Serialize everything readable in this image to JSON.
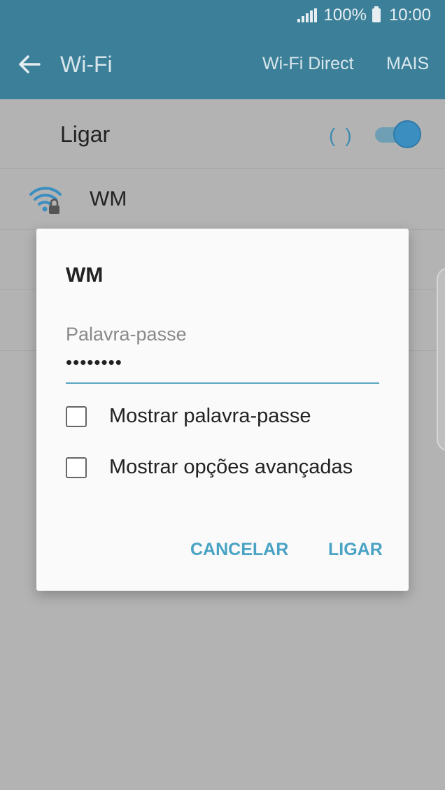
{
  "status_bar": {
    "battery_text": "100%",
    "time": "10:00"
  },
  "action_bar": {
    "title": "Wi-Fi",
    "wifi_direct": "Wi-Fi Direct",
    "more": "MAIS"
  },
  "wifi_toggle": {
    "label": "Ligar",
    "on": true
  },
  "networks": [
    {
      "name": "WM",
      "secured": true
    }
  ],
  "dialog": {
    "title": "WM",
    "password_label": "Palavra-passe",
    "password_value": "••••••••",
    "options": [
      {
        "label": "Mostrar palavra-passe",
        "checked": false
      },
      {
        "label": "Mostrar opções avançadas",
        "checked": false
      }
    ],
    "cancel_label": "CANCELAR",
    "connect_label": "LIGAR"
  },
  "colors": {
    "accent": "#4aa3c4",
    "action_bar": "#3c7f98",
    "dim_background": "#b3b3b3"
  }
}
